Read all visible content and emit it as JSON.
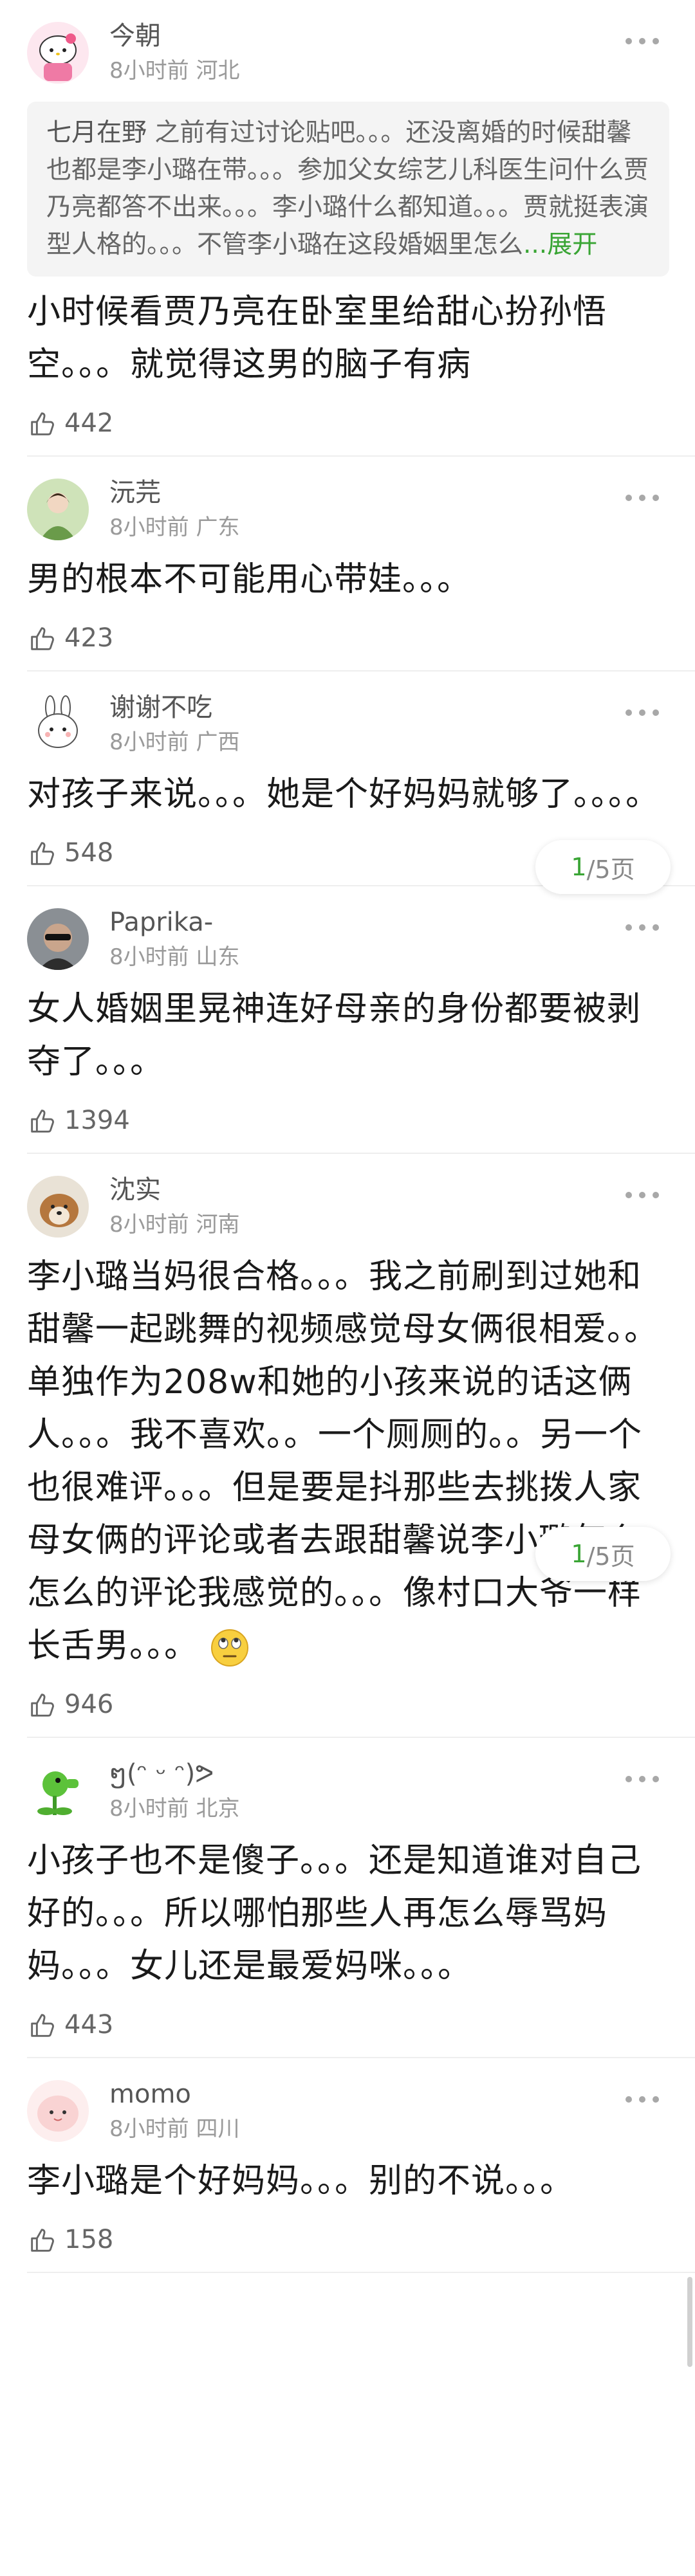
{
  "colors": {
    "accent_green": "#3aa535",
    "meta_gray": "#9a9a9a",
    "divider": "#eeeeee"
  },
  "comments": [
    {
      "username": "今朝",
      "time": "8小时前",
      "location": "河北",
      "avatar": "hello-kitty-avatar",
      "quote": {
        "name": "七月在野",
        "text": " 之前有过讨论贴吧。。。还没离婚的时候甜馨也都是李小璐在带。。。参加父女综艺儿科医生问什么贾乃亮都答不出来。。。李小璐什么都知道。。。贾就挺表演型人格的。。。不管李小璐在这段婚姻里怎么",
        "expand": "...展开"
      },
      "text": "小时候看贾乃亮在卧室里给甜心扮孙悟空。。。就觉得这男的脑子有病",
      "likes": "442"
    },
    {
      "username": "沅芫",
      "time": "8小时前",
      "location": "广东",
      "avatar": "girl-green-avatar",
      "text": "男的根本不可能用心带娃。。。",
      "likes": "423"
    },
    {
      "username": "谢谢不吃",
      "time": "8小时前",
      "location": "广西",
      "avatar": "bunny-avatar",
      "text": "对孩子来说。。。她是个好妈妈就够了。。。。",
      "likes": "548"
    },
    {
      "username": "Paprika-",
      "time": "8小时前",
      "location": "山东",
      "avatar": "sunglasses-avatar",
      "text": "女人婚姻里晃神连好母亲的身份都要被剥夺了。。。",
      "likes": "1394"
    },
    {
      "username": "沈实",
      "time": "8小时前",
      "location": "河南",
      "avatar": "dog-avatar",
      "text": "李小璐当妈很合格。。。我之前刷到过她和甜馨一起跳舞的视频感觉母女俩很相爱。。单独作为208w和她的小孩来说的话这俩人。。。我不喜欢。。一个厕厕的。。另一个也很难评。。。但是要是抖那些去挑拨人家母女俩的评论或者去跟甜馨说李小璐怎么怎么的评论我感觉的。。。像村口大爷一样长舌男。。。",
      "likes": "946"
    },
    {
      "username": "ໆ(ᵔ ᵕ ᵔ)ᕗ",
      "time": "8小时前",
      "location": "北京",
      "avatar": "peashooter-avatar",
      "text": "小孩子也不是傻子。。。还是知道谁对自己好的。。。所以哪怕那些人再怎么辱骂妈妈。。。女儿还是最爱妈咪。。。",
      "likes": "443"
    },
    {
      "username": "momo",
      "time": "8小时前",
      "location": "四川",
      "avatar": "pink-blob-avatar",
      "text": "李小璐是个好妈妈。。。别的不说。。。",
      "likes": "158"
    }
  ],
  "pager": {
    "current": "1",
    "total_label": "/5页"
  }
}
